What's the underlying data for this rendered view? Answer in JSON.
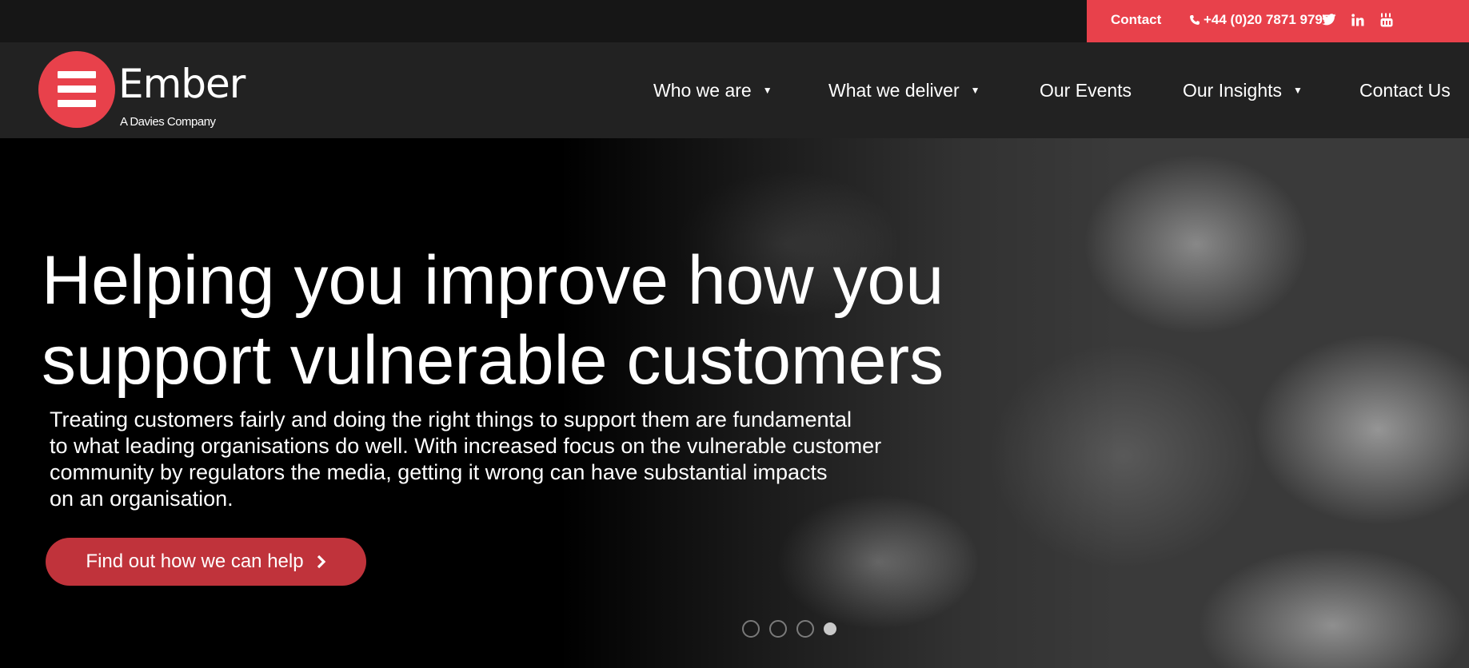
{
  "topbar": {
    "contact_label": "Contact",
    "phone": "+44 (0)20 7871 9797",
    "social": [
      "twitter-icon",
      "linkedin-icon",
      "youtube-icon"
    ]
  },
  "logo": {
    "word": "Ember",
    "sub": "A Davies Company"
  },
  "nav": {
    "items": [
      {
        "label": "Who we are",
        "has_dropdown": true
      },
      {
        "label": "What we deliver",
        "has_dropdown": true
      },
      {
        "label": "Our Events",
        "has_dropdown": false
      },
      {
        "label": "Our Insights",
        "has_dropdown": true
      },
      {
        "label": "Contact Us",
        "has_dropdown": false
      }
    ]
  },
  "hero": {
    "title_line1": "Helping you improve how you",
    "title_line2": "support vulnerable customers",
    "text_line1": "Treating customers fairly and doing the right things to support them are fundamental",
    "text_line2": "to what leading organisations do well. With increased focus on the vulnerable customer",
    "text_line3": "community by regulators the media, getting it wrong can have substantial impacts",
    "text_line4": "on an organisation.",
    "button_label": "Find out how we can help",
    "slides_total": 4,
    "active_slide": 4
  },
  "colors": {
    "brand_red": "#e8414b",
    "button_red": "#c0333b",
    "nav_bg": "#222222",
    "topbar_bg": "#161616"
  }
}
